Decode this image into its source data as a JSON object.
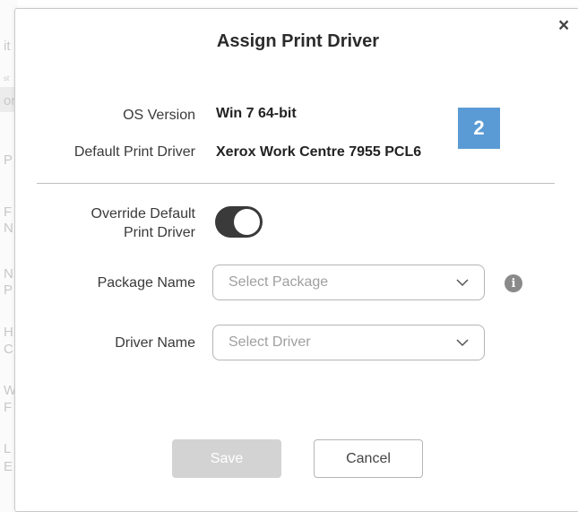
{
  "background": {
    "fragments": [
      "it",
      "st",
      "or",
      "P",
      "F",
      "N",
      "N",
      "P",
      "H",
      "C",
      "W",
      "F",
      "L",
      "E"
    ]
  },
  "dialog": {
    "title": "Assign Print Driver",
    "close_label": "×",
    "step_badge": "2",
    "os_version_label": "OS Version",
    "os_version_value": "Win 7 64-bit",
    "default_driver_label": "Default Print Driver",
    "default_driver_value": "Xerox Work Centre 7955 PCL6",
    "override_label_line1": "Override Default",
    "override_label_line2": "Print Driver",
    "override_enabled": true,
    "package_label": "Package Name",
    "package_placeholder": "Select Package",
    "package_info_icon": "i",
    "driver_label": "Driver Name",
    "driver_placeholder": "Select Driver",
    "save_label": "Save",
    "save_disabled": true,
    "cancel_label": "Cancel"
  },
  "colors": {
    "badge": "#5b9bd5",
    "toggle_on": "#3a3a3a",
    "save_disabled": "#d3d3d3"
  }
}
